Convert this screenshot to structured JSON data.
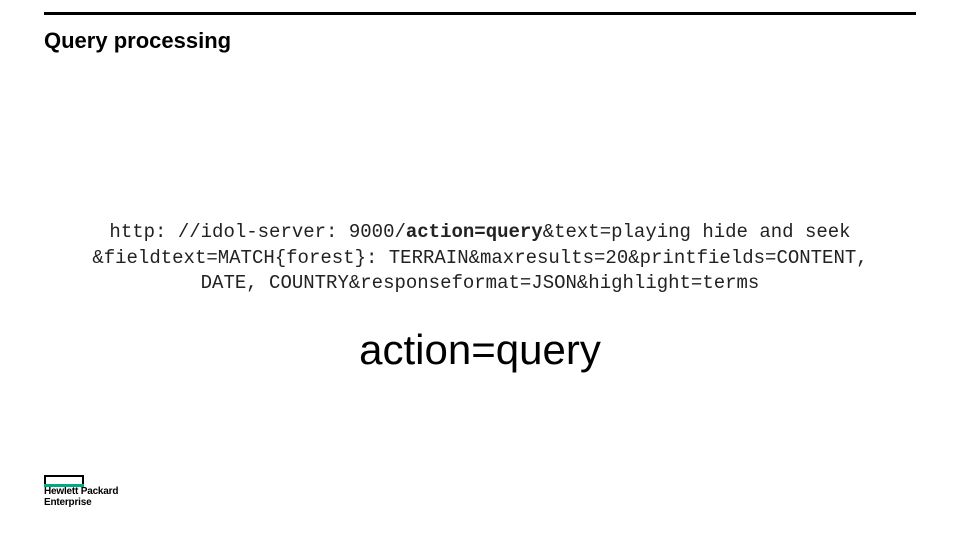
{
  "title": "Query processing",
  "url": {
    "prefix": "http: //idol-server: 9000/",
    "action_bold": "action=query",
    "rest_line1": "&text=playing hide and seek",
    "line2": "&fieldtext=MATCH{forest}: TERRAIN&maxresults=20&printfields=CONTENT,",
    "line3": "DATE, COUNTRY&responseformat=JSON&highlight=terms"
  },
  "big_action": "action=query",
  "logo": {
    "line1": "Hewlett Packard",
    "line2": "Enterprise"
  }
}
